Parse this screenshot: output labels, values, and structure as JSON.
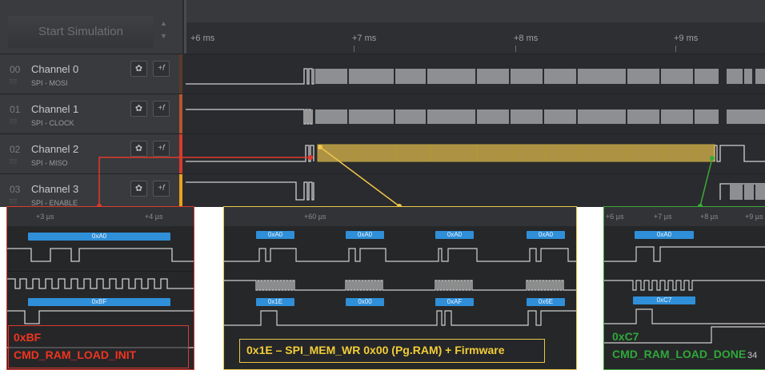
{
  "sidebar": {
    "start_button": "Start Simulation",
    "channels": [
      {
        "num": "00",
        "name": "Channel 0",
        "sub": "SPI - MOSI",
        "stripe": "#5a3a2a"
      },
      {
        "num": "01",
        "name": "Channel 1",
        "sub": "SPI - CLOCK",
        "stripe": "#b5562c"
      },
      {
        "num": "02",
        "name": "Channel 2",
        "sub": "SPI - MISO",
        "stripe": "#d93a2e"
      },
      {
        "num": "03",
        "name": "Channel 3",
        "sub": "SPI - ENABLE",
        "stripe": "#e8a21a"
      }
    ],
    "gear_icon": "gear-icon",
    "trigger_icon": "+f"
  },
  "timeline": {
    "ticks": [
      "+6 ms",
      "+7 ms",
      "+8 ms",
      "+9 ms"
    ]
  },
  "zoom_panels": {
    "red": {
      "ticks": [
        "+3 µs",
        "+4 µs"
      ],
      "mosi_value": "0xA0",
      "miso_value": "0xBF",
      "label_line1": "0xBF",
      "label_line2": "CMD_RAM_LOAD_INIT",
      "color": "#d93a2e"
    },
    "yellow": {
      "ticks": [
        "+60 µs"
      ],
      "mosi_values": [
        "0xA0",
        "0xA0",
        "0xA0",
        "0xA0"
      ],
      "miso_values": [
        "0x1E",
        "0x00",
        "0xAF",
        "0x6E"
      ],
      "label": "0x1E – SPI_MEM_WR 0x00 (Pg.RAM)  + Firmware",
      "color": "#e6c84a"
    },
    "green": {
      "ticks": [
        "+6 µs",
        "+7 µs",
        "+8 µs",
        "+9 µs"
      ],
      "mosi_value": "0xA0",
      "miso_value": "0xC7",
      "label_line1": "0xC7",
      "label_line2": "CMD_RAM_LOAD_DONE",
      "color": "#3aa93a"
    }
  },
  "slide_number": "34",
  "colors": {
    "highlight": "#d9b54a",
    "accent_blue": "#2f8fd8",
    "signal": "#d0d0d0"
  }
}
